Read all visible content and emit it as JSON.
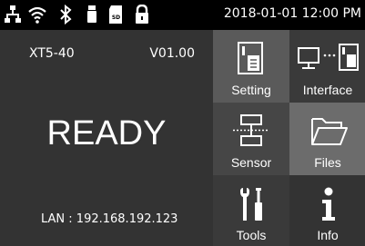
{
  "status_bar": {
    "datetime": "2018-01-01 12:00 PM",
    "icons": [
      "network-icon",
      "wifi-icon",
      "bluetooth-icon",
      "usb-icon",
      "sd-card-icon",
      "lock-icon"
    ],
    "sd_label": "SD"
  },
  "device": {
    "model": "XT5-40",
    "version": "V01.00",
    "status": "READY",
    "lan": "LAN : 192.168.192.123"
  },
  "menu": {
    "setting": "Setting",
    "interface": "Interface",
    "sensor": "Sensor",
    "files": "Files",
    "tools": "Tools",
    "info": "Info"
  },
  "colors": {
    "background": "#000000",
    "panel": "#333333",
    "tile_dark": "#3a3a3a",
    "tile_gray": "#5a5a5a",
    "tile_mid": "#464646",
    "tile_light": "#6c6c6c",
    "text": "#ffffff"
  }
}
